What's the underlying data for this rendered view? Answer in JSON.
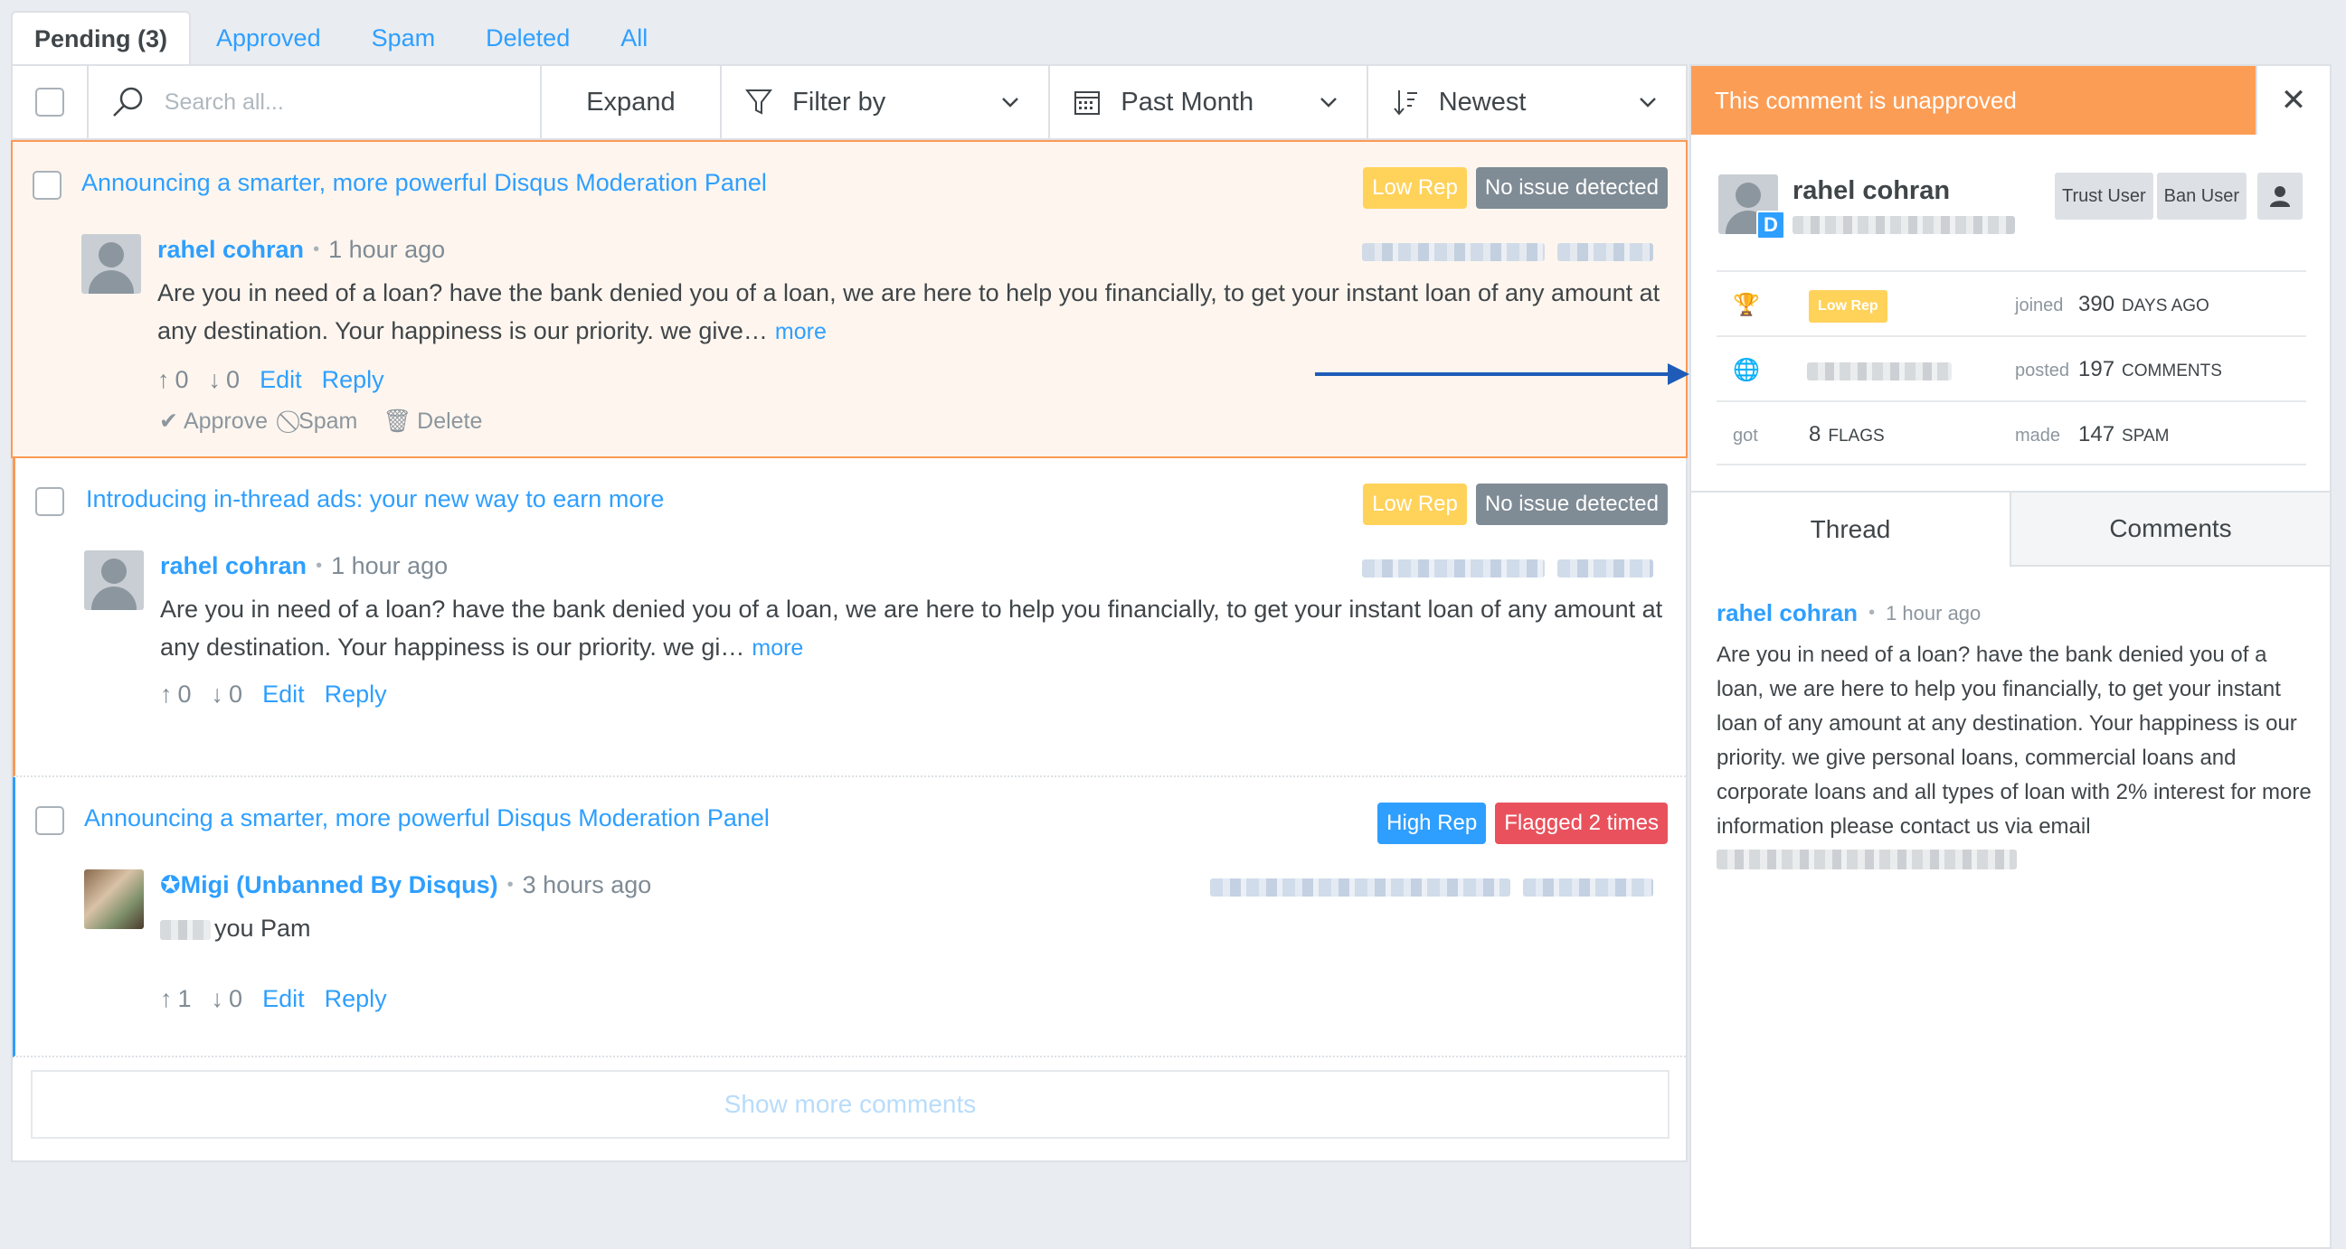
{
  "tabs": [
    {
      "label": "Pending (3)",
      "active": true
    },
    {
      "label": "Approved",
      "active": false
    },
    {
      "label": "Spam",
      "active": false
    },
    {
      "label": "Deleted",
      "active": false
    },
    {
      "label": "All",
      "active": false
    }
  ],
  "toolbar": {
    "search_placeholder": "Search all...",
    "expand": "Expand",
    "filter": "Filter by",
    "date": "Past Month",
    "sort": "Newest"
  },
  "comments": [
    {
      "thread_title": "Announcing a smarter, more powerful Disqus Moderation Panel",
      "badges": [
        "Low Rep",
        "No issue detected"
      ],
      "author": "rahel cohran",
      "time": "1 hour ago",
      "text": "Are you in need of a loan? have the bank denied you of a loan, we are here to help you financially, to get your instant loan of any amount at any destination. Your happiness is our priority. we give…",
      "more": "more",
      "upvotes": "0",
      "downvotes": "0",
      "edit": "Edit",
      "reply": "Reply",
      "approve": "Approve",
      "spam": "Spam",
      "delete": "Delete"
    },
    {
      "thread_title": "Introducing in-thread ads: your new way to earn more",
      "badges": [
        "Low Rep",
        "No issue detected"
      ],
      "author": "rahel cohran",
      "time": "1 hour ago",
      "text": "Are you in need of a loan? have the bank denied you of a loan, we are here to help you financially, to get your instant loan of any amount at any destination. Your happiness is our priority. we gi…",
      "more": "more",
      "upvotes": "0",
      "downvotes": "0",
      "edit": "Edit",
      "reply": "Reply"
    },
    {
      "thread_title": "Announcing a smarter, more powerful Disqus Moderation Panel",
      "badges": [
        "High Rep",
        "Flagged 2 times"
      ],
      "author": "Migi (Unbanned By Disqus)",
      "time": "3 hours ago",
      "text": "you Pam",
      "upvotes": "1",
      "downvotes": "0",
      "edit": "Edit",
      "reply": "Reply"
    }
  ],
  "show_more": "Show more comments",
  "side": {
    "banner": "This comment is unapproved",
    "close": "✕",
    "user_name": "rahel cohran",
    "trust_user": "Trust User",
    "ban_user": "Ban User",
    "rep_badge": "Low Rep",
    "joined_label": "joined",
    "joined_value": "390",
    "joined_unit": "DAYS AGO",
    "posted_label": "posted",
    "posted_value": "197",
    "posted_unit": "COMMENTS",
    "got_label": "got",
    "flags_value": "8",
    "flags_unit": "FLAGS",
    "made_label": "made",
    "spam_value": "147",
    "spam_unit": "SPAM",
    "tab_thread": "Thread",
    "tab_comments": "Comments",
    "thread_author": "rahel cohran",
    "thread_time": "1 hour ago",
    "thread_text": "Are you in need of a loan? have the bank denied you of a loan, we are here to help you financially, to get your instant loan of any amount at any destination. Your happiness is our priority. we give personal loans, commercial loans and corporate loans and all types of loan with 2% interest for more information please contact us via email"
  },
  "colors": {
    "accent_blue": "#2e9fff",
    "pending_orange": "#fb9a55",
    "low_rep_yellow": "#ffd25a",
    "flag_red": "#e9525d",
    "neutral_gray": "#7f8b95"
  },
  "icons": {
    "search": "search-icon",
    "filter": "funnel-icon",
    "date": "calendar-icon",
    "sort": "sort-icon",
    "upvote": "arrow-up-icon",
    "downvote": "arrow-down-icon",
    "approve": "check-icon",
    "spam": "block-icon",
    "delete": "trash-icon",
    "trophy": "trophy-icon",
    "globe": "globe-icon",
    "user": "user-icon"
  }
}
